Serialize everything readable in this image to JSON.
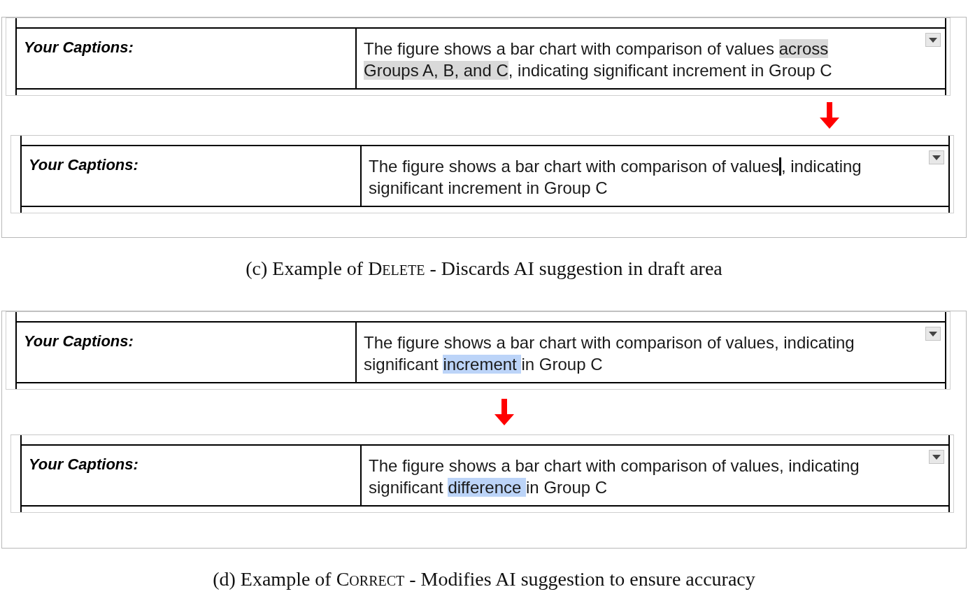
{
  "panels": [
    {
      "snippets": [
        {
          "label": "Your Captions:",
          "segments": [
            {
              "text": "The figure shows a bar chart with comparison of values ",
              "kind": "plain",
              "caret": false
            },
            {
              "text": "across Groups A, B, and C",
              "kind": "suggestion",
              "caret": false
            },
            {
              "text": ", indicating significant increment in Group C",
              "kind": "plain",
              "caret": false
            }
          ]
        },
        {
          "label": "Your Captions:",
          "segments": [
            {
              "text": "The figure shows a bar chart with comparison of values",
              "kind": "plain",
              "caret": true
            },
            {
              "text": ", indicating significant increment in Group C",
              "kind": "plain",
              "caret": false
            }
          ]
        }
      ],
      "caption": {
        "prefix": "(c) Example of ",
        "keyword": "Delete",
        "suffix": " - Discards AI suggestion in draft area"
      }
    },
    {
      "snippets": [
        {
          "label": "Your Captions:",
          "segments": [
            {
              "text": "The figure shows a bar chart with comparison of values, indicating significant ",
              "kind": "plain",
              "caret": false
            },
            {
              "text": "increment ",
              "kind": "selection",
              "caret": false
            },
            {
              "text": "in Group C",
              "kind": "plain",
              "caret": false
            }
          ]
        },
        {
          "label": "Your Captions:",
          "segments": [
            {
              "text": "The figure shows a bar chart with comparison of values, indicating significant ",
              "kind": "plain",
              "caret": false
            },
            {
              "text": "difference ",
              "kind": "selection",
              "caret": false
            },
            {
              "text": "in Group C",
              "kind": "plain",
              "caret": false
            }
          ]
        }
      ],
      "caption": {
        "prefix": "(d) Example of ",
        "keyword": "Correct",
        "suffix": " - Modifies AI suggestion to ensure accuracy"
      }
    }
  ]
}
